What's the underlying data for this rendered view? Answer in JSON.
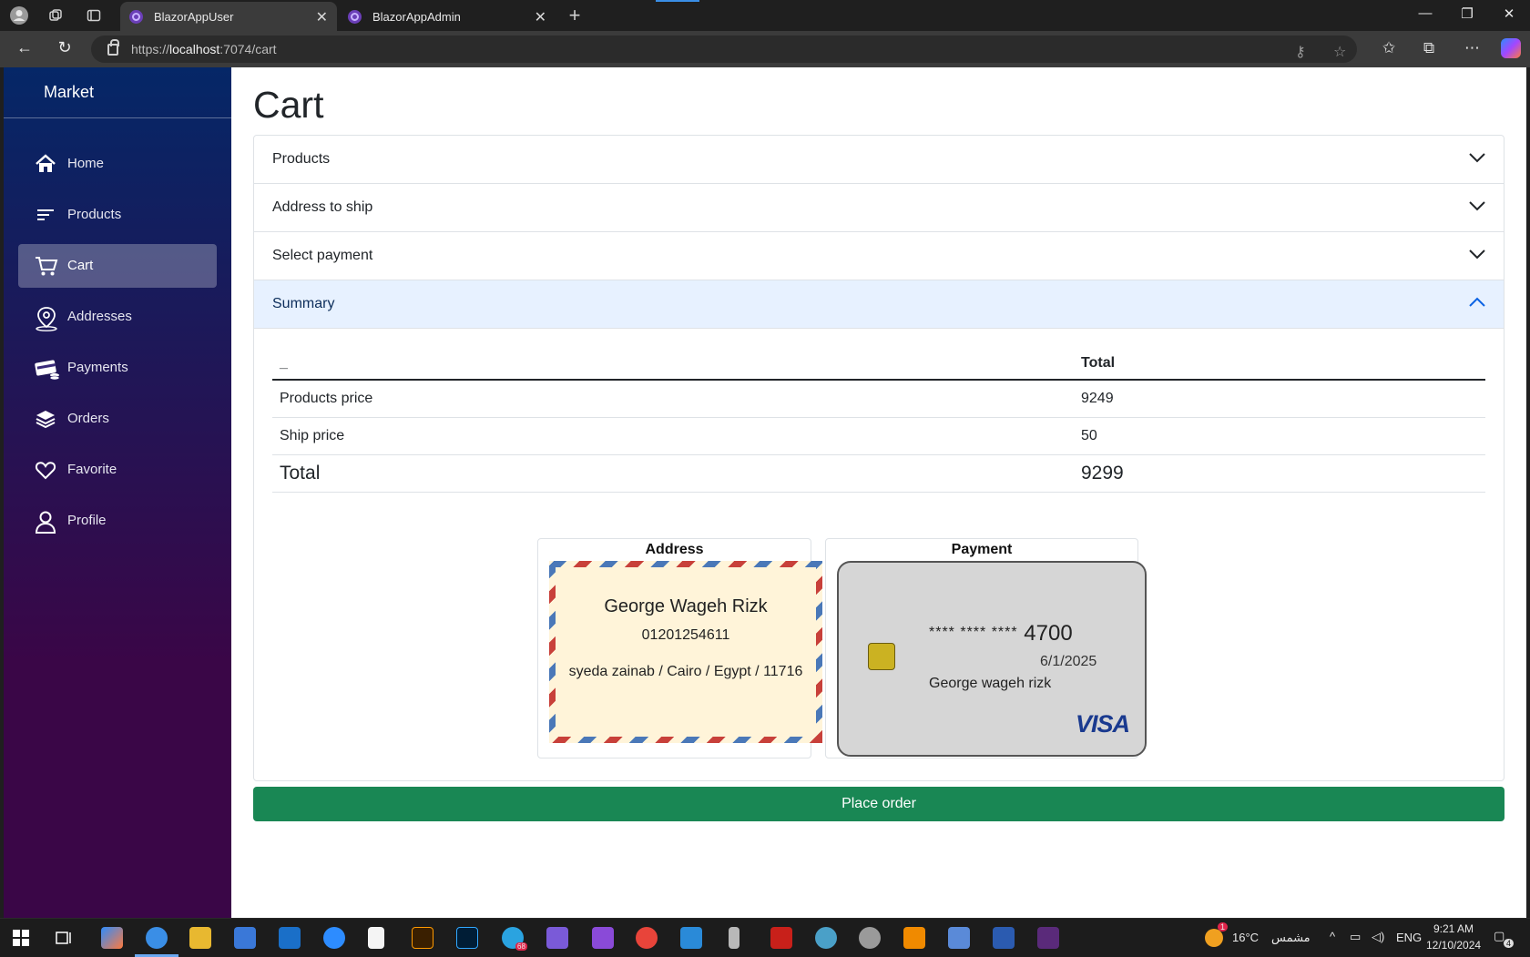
{
  "browser": {
    "tabs": [
      {
        "label": "BlazorAppUser",
        "active": true
      },
      {
        "label": "BlazorAppAdmin",
        "active": false
      }
    ],
    "url_scheme": "https://",
    "url_host": "localhost",
    "url_rest": ":7074/cart"
  },
  "sidebar": {
    "brand": "Market",
    "items": [
      {
        "label": "Home",
        "icon": "home-icon"
      },
      {
        "label": "Products",
        "icon": "list-icon"
      },
      {
        "label": "Cart",
        "icon": "cart-icon",
        "active": true
      },
      {
        "label": "Addresses",
        "icon": "location-pin-icon"
      },
      {
        "label": "Payments",
        "icon": "payments-icon"
      },
      {
        "label": "Orders",
        "icon": "layers-icon"
      },
      {
        "label": "Favorite",
        "icon": "heart-icon"
      },
      {
        "label": "Profile",
        "icon": "person-icon"
      }
    ]
  },
  "page": {
    "title": "Cart",
    "sections": [
      {
        "label": "Products",
        "expanded": false
      },
      {
        "label": "Address to ship",
        "expanded": false
      },
      {
        "label": "Select payment",
        "expanded": false
      },
      {
        "label": "Summary",
        "expanded": true
      }
    ],
    "summary": {
      "headers": [
        "_",
        "Total"
      ],
      "rows": [
        {
          "label": "Products price",
          "value": "9249"
        },
        {
          "label": "Ship price",
          "value": "50"
        },
        {
          "label": "Total",
          "value": "9299"
        }
      ]
    },
    "address_box": {
      "title": "Address",
      "name": "George Wageh Rizk",
      "phone": "01201254611",
      "address": "syeda zainab / Cairo / Egypt / 11716"
    },
    "payment_box": {
      "title": "Payment",
      "card_stars": "**** **** ****",
      "card_last4": "4700",
      "expiry": "6/1/2025",
      "holder": "George wageh rizk",
      "brand": "VISA"
    },
    "place_order_label": "Place order"
  },
  "taskbar": {
    "weather_temp": "16°C",
    "weather_text": "مشمس",
    "language": "ENG",
    "time": "9:21 AM",
    "date": "12/10/2024",
    "telegram_badge": "68",
    "notification_count": "4",
    "weather_badge": "1"
  },
  "colors": {
    "sidebar_top": "#052767",
    "sidebar_bottom": "#3a0647",
    "accordion_open": "#e7f1ff",
    "place_order": "#198754",
    "card_chip": "#cbb222"
  }
}
